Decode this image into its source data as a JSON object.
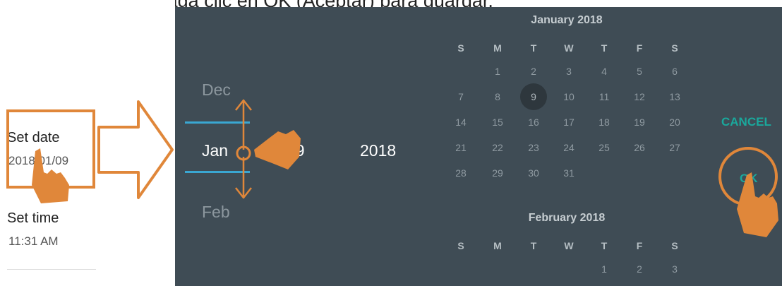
{
  "caption": "y, a continuación, haga clic en OK (Aceptar) para guardar.",
  "settings": {
    "date_title": "Set date",
    "date_value": "2018/01/09",
    "time_title": "Set time",
    "time_value": "11:31 AM"
  },
  "spinner": {
    "prev_month": "Dec",
    "month": "Jan",
    "next_month": "Feb",
    "day": "09",
    "year": "2018"
  },
  "calendar": {
    "month1": "January 2018",
    "month2": "February 2018",
    "weekdays": [
      "S",
      "M",
      "T",
      "W",
      "T",
      "F",
      "S"
    ],
    "jan_weeks": [
      [
        "",
        "1",
        "2",
        "3",
        "4",
        "5",
        "6"
      ],
      [
        "7",
        "8",
        "9",
        "10",
        "11",
        "12",
        "13"
      ],
      [
        "14",
        "15",
        "16",
        "17",
        "18",
        "19",
        "20"
      ],
      [
        "21",
        "22",
        "23",
        "24",
        "25",
        "26",
        "27"
      ],
      [
        "28",
        "29",
        "30",
        "31",
        "",
        "",
        ""
      ]
    ],
    "selected_day": "9",
    "feb_week1": [
      "",
      "",
      "",
      "",
      "1",
      "2",
      "3"
    ]
  },
  "buttons": {
    "cancel": "CANCEL",
    "ok": "OK"
  },
  "colors": {
    "accent": "#e0873a",
    "teal": "#1aa89c",
    "picker_bg": "#3f4c55",
    "line": "#3aa7d2"
  }
}
